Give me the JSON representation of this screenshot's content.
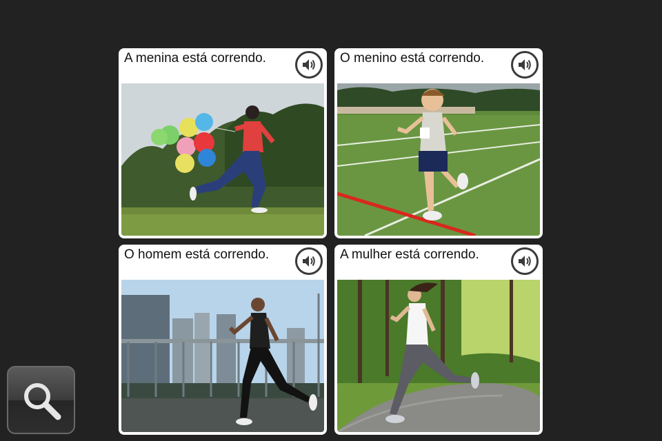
{
  "cards": [
    {
      "caption": "A menina está correndo.",
      "speaker_icon": "speaker-icon",
      "image": "girl-running-with-balloons"
    },
    {
      "caption": "O menino está correndo.",
      "speaker_icon": "speaker-icon",
      "image": "boy-running-on-track"
    },
    {
      "caption": "O homem está correndo.",
      "speaker_icon": "speaker-icon",
      "image": "man-running-on-bridge"
    },
    {
      "caption": "A mulher está correndo.",
      "speaker_icon": "speaker-icon",
      "image": "woman-running-on-path"
    }
  ],
  "search_button": {
    "icon": "magnifier-icon"
  },
  "colors": {
    "background": "#222222",
    "card": "#ffffff",
    "icon": "#3a3a3a"
  }
}
